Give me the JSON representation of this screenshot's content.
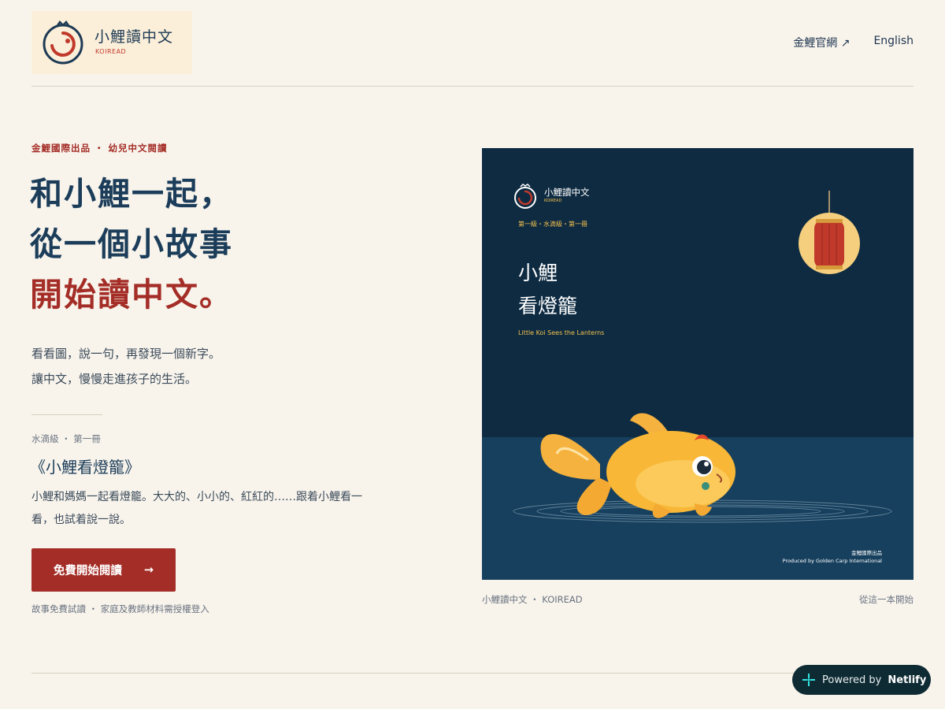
{
  "header": {
    "brand_name": "小鯉讀中文",
    "brand_sub": "KOIREAD",
    "nav": [
      {
        "label": "金鯉官網 ↗"
      },
      {
        "label": "English"
      }
    ]
  },
  "hero": {
    "eyebrow": "金鯉國際出品 ・ 幼兒中文閱讀",
    "headline_line1": "和小鯉一起，",
    "headline_line2": "從一個小故事",
    "headline_line3": "開始讀中文。",
    "lead_line1": "看看圖，說一句，再發現一個新字。",
    "lead_line2": "讓中文，慢慢走進孩子的生活。",
    "book_meta": "水滴級 ・ 第一冊",
    "book_title": "《小鯉看燈籠》",
    "book_desc": "小鯉和媽媽一起看燈籠。大大的、小小的、紅紅的……跟着小鯉看一看，也試着說一說。",
    "cta_label": "免費開始閱讀",
    "cta_arrow": "→",
    "cta_note": "故事免費試讀 ・ 家庭及教師材料需授權登入"
  },
  "cover": {
    "brand": "小鯉讀中文",
    "brand_sub": "KOIREAD",
    "level": "第一級・水滴級・第一冊",
    "title_line1": "小鯉",
    "title_line2": "看燈籠",
    "title_en": "Little Koi Sees the Lanterns",
    "credit_zh": "金鯉國際出品",
    "credit_en": "Produced by Golden Carp International",
    "caption_left": "小鯉讀中文 ・ KOIREAD",
    "caption_right": "從這一本開始"
  },
  "badge": {
    "prefix": "Powered by",
    "brand": "Netlify"
  },
  "colors": {
    "background": "#f8f4ec",
    "accent_red": "#a42e27",
    "navy": "#1c3d5a",
    "cover_bg": "#0e2b42",
    "gold": "#f3c04c"
  }
}
